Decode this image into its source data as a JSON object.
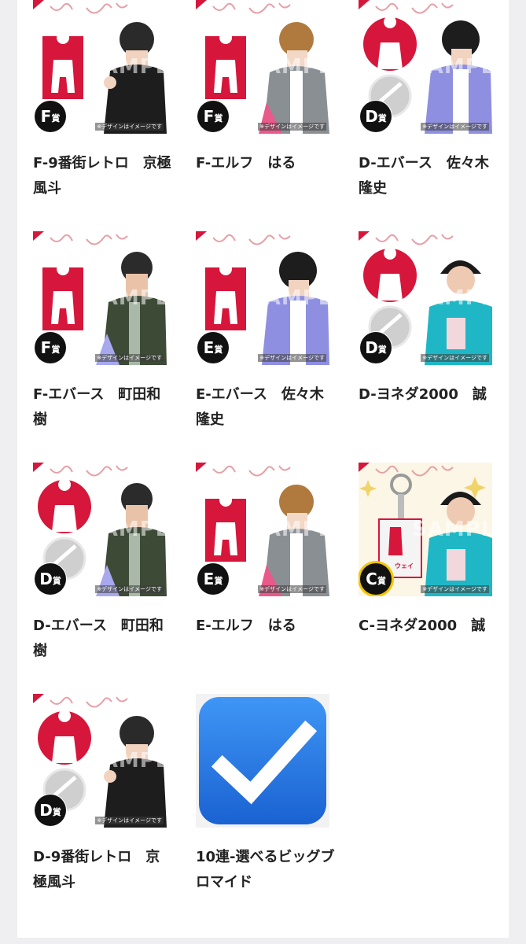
{
  "watermark": "SAMPLE",
  "caption": "※デザインはイメージです",
  "colors": {
    "brand_red": "#d6163b",
    "badge_black": "#111111",
    "c_badge_ring": "#f3c400",
    "check_blue": "#2a7be4"
  },
  "items": [
    {
      "badge_letter": "F",
      "badge_suffix": "賞",
      "name": "F-9番街レトロ　京極風斗",
      "goods": "acrylic-stand-icon"
    },
    {
      "badge_letter": "F",
      "badge_suffix": "賞",
      "name": "F-エルフ　はる",
      "goods": "acrylic-stand-icon"
    },
    {
      "badge_letter": "D",
      "badge_suffix": "賞",
      "name": "D-エバース　佐々木隆史",
      "goods": "badge-and-mirror-icon"
    },
    {
      "badge_letter": "F",
      "badge_suffix": "賞",
      "name": "F-エバース　町田和樹",
      "goods": "acrylic-stand-icon"
    },
    {
      "badge_letter": "E",
      "badge_suffix": "賞",
      "name": "E-エバース　佐々木隆史",
      "goods": "acrylic-stand-icon"
    },
    {
      "badge_letter": "D",
      "badge_suffix": "賞",
      "name": "D-ヨネダ2000　誠",
      "goods": "badge-and-mirror-icon"
    },
    {
      "badge_letter": "D",
      "badge_suffix": "賞",
      "name": "D-エバース　町田和樹",
      "goods": "badge-and-mirror-icon"
    },
    {
      "badge_letter": "E",
      "badge_suffix": "賞",
      "name": "E-エルフ　はる",
      "goods": "acrylic-stand-icon"
    },
    {
      "badge_letter": "C",
      "badge_suffix": "賞",
      "name": "C-ヨネダ2000　誠",
      "goods": "acrylic-keychain-icon"
    },
    {
      "badge_letter": "D",
      "badge_suffix": "賞",
      "name": "D-9番街レトロ　京極風斗",
      "goods": "badge-and-mirror-icon"
    },
    {
      "badge_letter": "",
      "badge_suffix": "",
      "name": "10連-選べるビッグブロマイド",
      "goods": "checkmark-icon"
    }
  ]
}
